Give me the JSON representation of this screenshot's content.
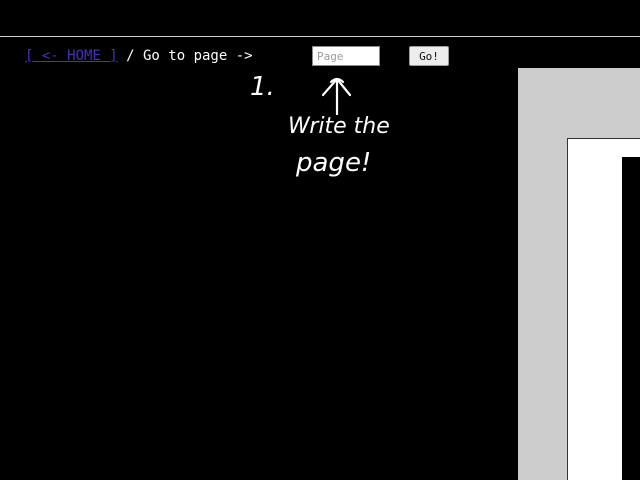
{
  "nav": {
    "home_link": "[ <- HOME ]",
    "separator": " / Go to page -> "
  },
  "page_input": {
    "value": "",
    "placeholder": "Page"
  },
  "go_button": {
    "label": "Go!"
  },
  "annotation": {
    "step": "1.",
    "hint_line1": "Write the",
    "hint_line2": "page!"
  },
  "colors": {
    "background": "#000000",
    "link": "#4a2fc0",
    "text": "#ffffff",
    "preview_frame": "#cccccc"
  }
}
